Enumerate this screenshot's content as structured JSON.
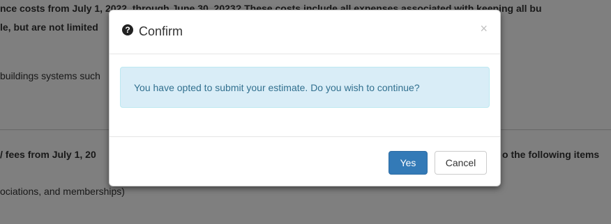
{
  "background": {
    "line1": "nce costs from July 1, 2022, through June 30, 2023? These costs include all expenses associated with keeping all bu",
    "line2": "le, but are not limited",
    "line3": "buildings systems such",
    "line4_left": "/ fees from July 1, 20",
    "line4_right": "o the following items",
    "line5": "ociations, and memberships)"
  },
  "modal": {
    "title": "Confirm",
    "title_icon": "question-circle-icon",
    "close_label": "×",
    "message": "You have opted to submit your estimate. Do you wish to continue?",
    "yes_label": "Yes",
    "cancel_label": "Cancel"
  },
  "colors": {
    "primary": "#337ab7",
    "alert_bg": "#d9edf7",
    "alert_text": "#31708f",
    "backdrop": "rgba(0,0,0,0.5)"
  }
}
